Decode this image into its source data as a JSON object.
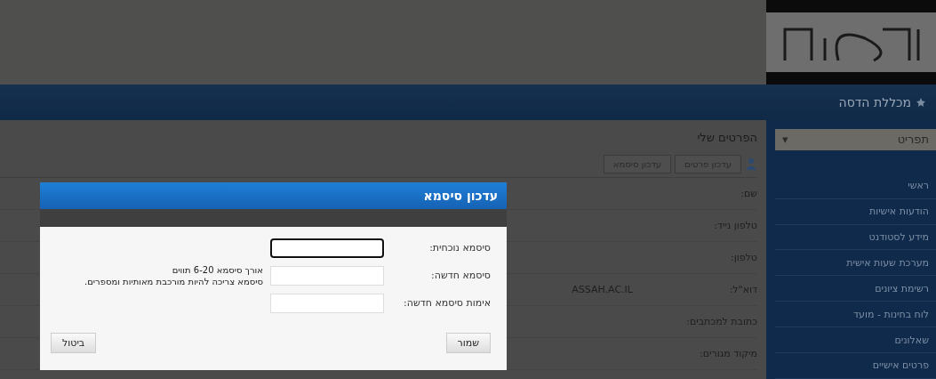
{
  "sidebar": {
    "heading": "מכללת הדסה",
    "menu_select": "תפריט",
    "menu_caret": "▾",
    "items": [
      {
        "label": "ראשי"
      },
      {
        "label": "הודעות אישיות"
      },
      {
        "label": "מידע לסטודנט"
      },
      {
        "label": "מערכת שעות אישית"
      },
      {
        "label": "רשימת ציונים"
      },
      {
        "label": "לוח בחינות - מועד"
      },
      {
        "label": "שאלונים"
      },
      {
        "label": "פרטים אישיים"
      }
    ]
  },
  "profile": {
    "title": "הפרטים שלי",
    "tabs": [
      {
        "label": "עדכון פרטים"
      },
      {
        "label": "עדכון סיסמא"
      }
    ],
    "rows": [
      {
        "label": "שם:"
      },
      {
        "label": "טלפון נייד:"
      },
      {
        "label": "טלפון:"
      },
      {
        "label": "דוא\"ל:",
        "value": "ASSAH.AC.IL"
      },
      {
        "label": "כתובת למכתבים:"
      },
      {
        "label": "מיקוד מגורים:"
      }
    ]
  },
  "dialog": {
    "title": "עדכון סיסמא",
    "fields": [
      {
        "label": "סיסמא נוכחית:",
        "focused": true
      },
      {
        "label": "סיסמא חדשה:",
        "focused": false,
        "hints": [
          "אורך סיסמא 6-20 תווים",
          "סיסמא צריכה להיות מורכבת מאותיות ומספרים."
        ]
      },
      {
        "label": "אימות סיסמא חדשה:",
        "focused": false
      }
    ],
    "save": "שמור",
    "cancel": "ביטול"
  }
}
